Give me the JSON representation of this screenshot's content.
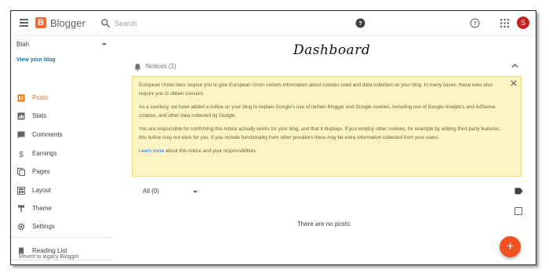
{
  "header": {
    "app_name": "Blogger",
    "logo_letter": "B",
    "search_placeholder": "Search",
    "avatar_initial": "S"
  },
  "sidebar": {
    "blog_name": "Blah",
    "view_blog": "View your blog",
    "items": [
      {
        "label": "Posts",
        "icon": "posts-icon",
        "active": true
      },
      {
        "label": "Stats",
        "icon": "stats-icon"
      },
      {
        "label": "Comments",
        "icon": "comments-icon"
      },
      {
        "label": "Earnings",
        "icon": "dollar-icon"
      },
      {
        "label": "Pages",
        "icon": "pages-icon"
      },
      {
        "label": "Layout",
        "icon": "layout-icon"
      },
      {
        "label": "Theme",
        "icon": "paint-roller-icon"
      },
      {
        "label": "Settings",
        "icon": "gear-icon"
      }
    ],
    "reading_list": "Reading List",
    "legacy_link": "Revert to legacy Blogger"
  },
  "main": {
    "annotation": "Dashboard",
    "notices_label": "Notices (1)",
    "notice_paragraphs": [
      "European Union laws require you to give European Union visitors information about cookies used and data collected on your blog. In many cases, these laws also require you to obtain consent.",
      "As a courtesy, we have added a notice on your blog to explain Google's use of certain Blogger and Google cookies, including use of Google Analytics and AdSense cookies, and other data collected by Google.",
      "You are responsible for confirming this notice actually works for your blog, and that it displays. If you employ other cookies, for example by adding third party features, this notice may not work for you. If you include functionality from other providers there may be extra information collected from your users."
    ],
    "learn_more": "Learn more",
    "learn_more_suffix": " about this notice and your responsibilities.",
    "filter_label": "All (0)",
    "empty_message": "There are no posts.",
    "fab_label": "+"
  },
  "colors": {
    "accent": "#e8710a",
    "logo": "#f06a35",
    "fab": "#f4511e",
    "notice_bg": "#fdf4c5",
    "avatar": "#c5221f",
    "link": "#1a73e8"
  }
}
